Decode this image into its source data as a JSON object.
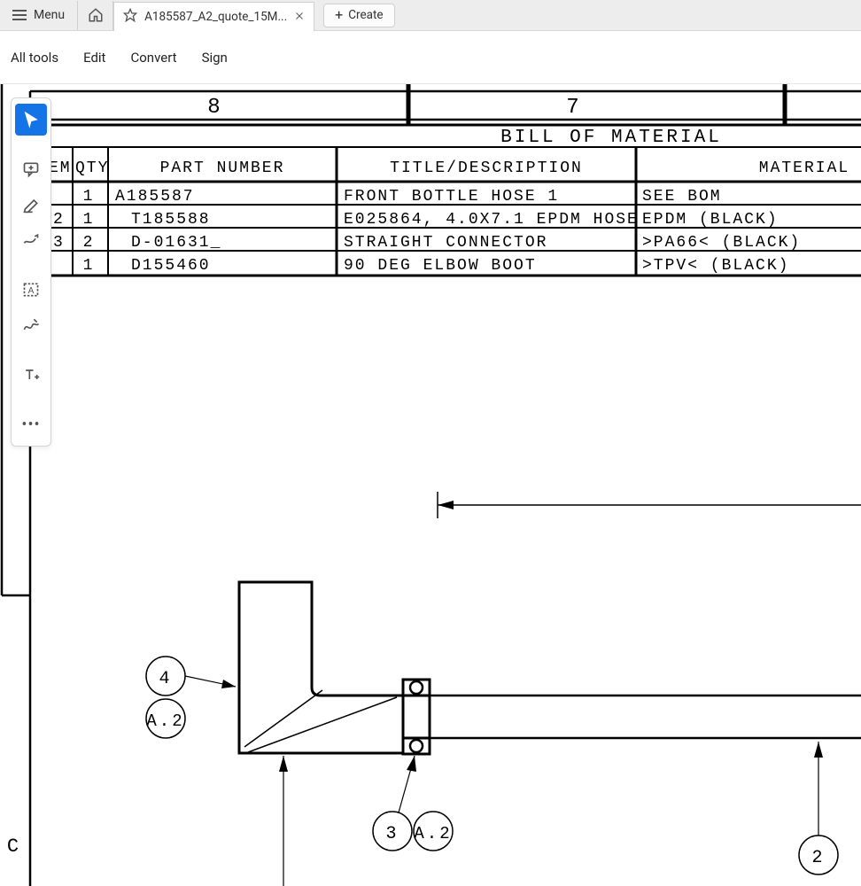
{
  "topbar": {
    "menu_label": "Menu",
    "tab_title": "A185587_A2_quote_15M...",
    "create_label": "Create"
  },
  "secondbar": {
    "all_tools": "All tools",
    "edit": "Edit",
    "convert": "Convert",
    "sign": "Sign"
  },
  "drawing": {
    "col8": "8",
    "col7": "7",
    "bom_title": "BILL OF MATERIAL",
    "headers": {
      "em": "EM",
      "qty": "QTY",
      "part_number": "PART NUMBER",
      "title_desc": "TITLE/DESCRIPTION",
      "material": "MATERIAL"
    },
    "rows": [
      {
        "qty": "1",
        "pn": "A185587",
        "desc": "FRONT BOTTLE HOSE 1",
        "mat": "SEE BOM",
        "pre": ""
      },
      {
        "qty": "1",
        "pn": "T185588",
        "desc": "E025864, 4.0X7.1 EPDM HOSE",
        "mat": "EPDM (BLACK)",
        "pre": "2"
      },
      {
        "qty": "2",
        "pn": "D-01631_",
        "desc": "STRAIGHT CONNECTOR",
        "mat": ">PA66< (BLACK)",
        "pre": "3"
      },
      {
        "qty": "1",
        "pn": "D155460",
        "desc": "90 DEG ELBOW BOOT",
        "mat": ">TPV< (BLACK)",
        "pre": ""
      }
    ],
    "row_c": "C",
    "balloon4": "4",
    "balloonA2": "A.2",
    "balloon3": "3",
    "balloonA2b": "A.2",
    "balloon2": "2"
  }
}
